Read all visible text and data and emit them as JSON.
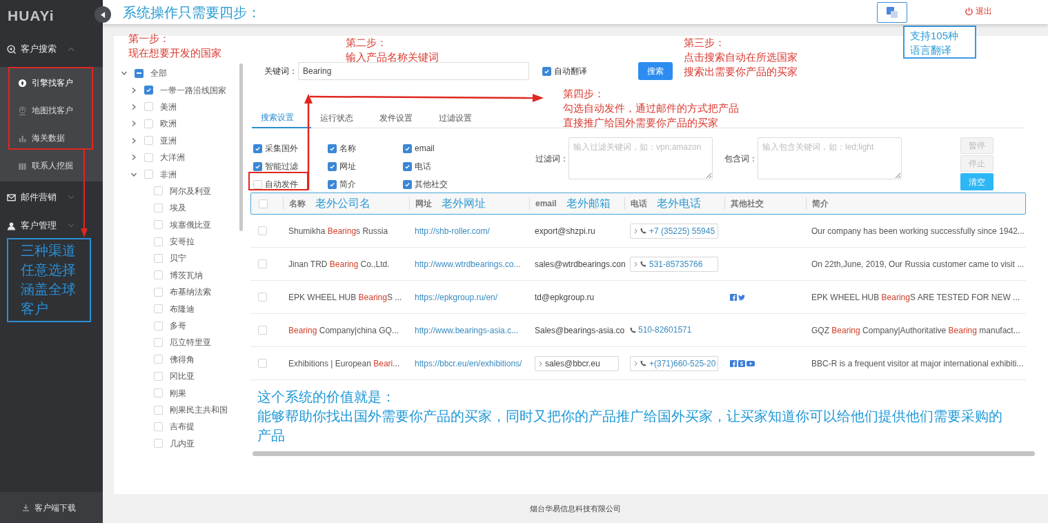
{
  "sidebar": {
    "logo": "HUAYi",
    "menu": [
      {
        "label": "客户搜索",
        "expanded": true,
        "children": [
          {
            "label": "引擎找客户",
            "selected": true
          },
          {
            "label": "地图找客户",
            "selected": false
          },
          {
            "label": "海关数据",
            "selected": false
          },
          {
            "label": "联系人挖掘",
            "selected": false
          }
        ]
      },
      {
        "label": "邮件营销",
        "expanded": false
      },
      {
        "label": "客户管理",
        "expanded": false
      }
    ],
    "download": "客户端下载"
  },
  "header": {
    "title": "系统操作只需要四步：",
    "logout": "退出"
  },
  "tree": [
    {
      "label": "全部",
      "partial": true,
      "expanded": true,
      "children": [
        {
          "label": "一带一路沿线国家",
          "checked": true,
          "expanded": false
        },
        {
          "label": "美洲",
          "checked": false,
          "expanded": false
        },
        {
          "label": "欧洲",
          "checked": false,
          "expanded": false
        },
        {
          "label": "亚洲",
          "checked": false,
          "expanded": false
        },
        {
          "label": "大洋洲",
          "checked": false,
          "expanded": false
        },
        {
          "label": "非洲",
          "checked": false,
          "expanded": true,
          "children": [
            {
              "label": "阿尔及利亚",
              "checked": false
            },
            {
              "label": "埃及",
              "checked": false
            },
            {
              "label": "埃塞俄比亚",
              "checked": false
            },
            {
              "label": "安哥拉",
              "checked": false
            },
            {
              "label": "贝宁",
              "checked": false
            },
            {
              "label": "博茨瓦纳",
              "checked": false
            },
            {
              "label": "布基纳法索",
              "checked": false
            },
            {
              "label": "布隆迪",
              "checked": false
            },
            {
              "label": "多哥",
              "checked": false
            },
            {
              "label": "厄立特里亚",
              "checked": false
            },
            {
              "label": "佛得角",
              "checked": false
            },
            {
              "label": "冈比亚",
              "checked": false
            },
            {
              "label": "刚果",
              "checked": false
            },
            {
              "label": "刚果民主共和国",
              "checked": false
            },
            {
              "label": "吉布提",
              "checked": false
            },
            {
              "label": "几内亚",
              "checked": false
            }
          ]
        }
      ]
    }
  ],
  "search": {
    "label": "关键词：",
    "value": "Bearing",
    "auto_translate": {
      "label": "自动翻译",
      "checked": true
    },
    "button": "搜索"
  },
  "tabs": [
    {
      "label": "搜索设置",
      "selected": true
    },
    {
      "label": "运行状态",
      "selected": false
    },
    {
      "label": "发件设置",
      "selected": false
    },
    {
      "label": "过滤设置",
      "selected": false
    }
  ],
  "options": [
    {
      "label": "采集国外",
      "checked": true
    },
    {
      "label": "名称",
      "checked": true
    },
    {
      "label": "email",
      "checked": true
    },
    {
      "label": "智能过滤",
      "checked": true
    },
    {
      "label": "网址",
      "checked": true
    },
    {
      "label": "电话",
      "checked": true
    },
    {
      "label": "自动发件",
      "checked": false
    },
    {
      "label": "简介",
      "checked": true
    },
    {
      "label": "其他社交",
      "checked": true
    }
  ],
  "filters": [
    {
      "label": "过滤词：",
      "placeholder": "输入过滤关键词，如：vpn;amazon"
    },
    {
      "label": "包含词：",
      "placeholder": "输入包含关键词，如：led;light"
    }
  ],
  "actions": [
    {
      "label": "暂停",
      "disabled": true
    },
    {
      "label": "停止",
      "disabled": true
    },
    {
      "label": "清空",
      "disabled": false
    }
  ],
  "table": {
    "header_checked": false,
    "columns": [
      {
        "label": "名称",
        "note": "老外公司名"
      },
      {
        "label": "网址",
        "note": "老外网址"
      },
      {
        "label": "email",
        "note": "老外邮箱"
      },
      {
        "label": "电话",
        "note": "老外电话"
      },
      {
        "label": "其他社交"
      },
      {
        "label": "简介"
      }
    ],
    "rows": [
      {
        "selected": false,
        "name": [
          {
            "text": "Shumikha ",
            "highlight": false
          },
          {
            "text": "Bearing",
            "highlight": true
          },
          {
            "text": "s Russia",
            "highlight": false
          }
        ],
        "url": "http://shb-roller.com/",
        "email": {
          "text": "export@shzpi.ru",
          "expandable": false
        },
        "phone": {
          "text": "+7 (35225) 55945",
          "expandable": true
        },
        "intro": [
          {
            "text": "Our company has been working successfully since 1942...",
            "highlight": false
          }
        ]
      },
      {
        "selected": false,
        "name": [
          {
            "text": "Jinan TRD ",
            "highlight": false
          },
          {
            "text": "Bearing",
            "highlight": true
          },
          {
            "text": " Co.,Ltd.",
            "highlight": false
          }
        ],
        "url": "http://www.wtrdbearings.co...",
        "email": {
          "text": "sales@wtrdbearings.con",
          "expandable": false
        },
        "phone": {
          "text": "531-85735766",
          "expandable": true
        },
        "intro": [
          {
            "text": "On 22th,June, 2019, Our Russia customer came to visit ...",
            "highlight": false
          }
        ]
      },
      {
        "selected": false,
        "name": [
          {
            "text": "EPK WHEEL HUB ",
            "highlight": false
          },
          {
            "text": "Bearing",
            "highlight": true
          },
          {
            "text": "S ...",
            "highlight": false
          }
        ],
        "url": "https://epkgroup.ru/en/",
        "email": {
          "text": "td@epkgroup.ru",
          "expandable": false
        },
        "social": [
          {
            "kind": "facebook"
          },
          {
            "kind": "twitter"
          }
        ],
        "intro": [
          {
            "text": "EPK WHEEL HUB ",
            "highlight": false
          },
          {
            "text": "Bearing",
            "highlight": true
          },
          {
            "text": "S ARE TESTED FOR NEW ...",
            "highlight": false
          }
        ]
      },
      {
        "selected": false,
        "name": [
          {
            "text": "Bearing",
            "highlight": true
          },
          {
            "text": " Company|china GQ...",
            "highlight": false
          }
        ],
        "url": "http://www.bearings-asia.c...",
        "email": {
          "text": "Sales@bearings-asia.co",
          "expandable": false
        },
        "phone": {
          "text": "510-82601571",
          "expandable": false
        },
        "intro": [
          {
            "text": "GQZ ",
            "highlight": false
          },
          {
            "text": "Bearing",
            "highlight": true
          },
          {
            "text": " Company|Authoritative ",
            "highlight": false
          },
          {
            "text": "Bearing",
            "highlight": true
          },
          {
            "text": " manufact...",
            "highlight": false
          }
        ]
      },
      {
        "selected": false,
        "name": [
          {
            "text": "Exhibitions | European ",
            "highlight": false
          },
          {
            "text": "Beari",
            "highlight": true
          },
          {
            "text": "...",
            "highlight": false
          }
        ],
        "url": "https://bbcr.eu/en/exhibitions/",
        "email": {
          "text": "sales@bbcr.eu",
          "expandable": true
        },
        "phone": {
          "text": "+(371)660-525-20",
          "expandable": true
        },
        "social": [
          {
            "kind": "facebook"
          },
          {
            "kind": "skype"
          },
          {
            "kind": "youtube"
          }
        ],
        "intro": [
          {
            "text": "BBC-R is a frequent visitor at major international exhibiti...",
            "highlight": false
          }
        ]
      }
    ]
  },
  "summary": [
    "这个系统的价值就是：",
    "能够帮助你找出国外需要你产品的买家，同时又把你的产品推广给国外买家，让买家知道你可以给他们提供他们需要采购的产品"
  ],
  "footer": "烟台华易信息科技有限公司",
  "annotations": [
    {
      "kind": "red-note",
      "lines": [
        "第一步：",
        "现在想要开发的国家"
      ]
    },
    {
      "kind": "red-note",
      "lines": [
        "第二步：",
        "输入产品名称关键词"
      ]
    },
    {
      "kind": "red-note",
      "lines": [
        "第三步：",
        "点击搜索自动在所选国家",
        "搜索出需要你产品的买家"
      ]
    },
    {
      "kind": "red-note",
      "lines": [
        "第四步：",
        "勾选自动发件，通过邮件的方式把产品",
        "直接推广给国外需要你产品的买家"
      ]
    },
    {
      "kind": "blue-box",
      "lines": [
        "支持105种",
        "语言翻译"
      ]
    },
    {
      "kind": "blue-box-large",
      "lines": [
        "三种渠道",
        "任意选择",
        "涵盖全球",
        "客户"
      ]
    }
  ]
}
